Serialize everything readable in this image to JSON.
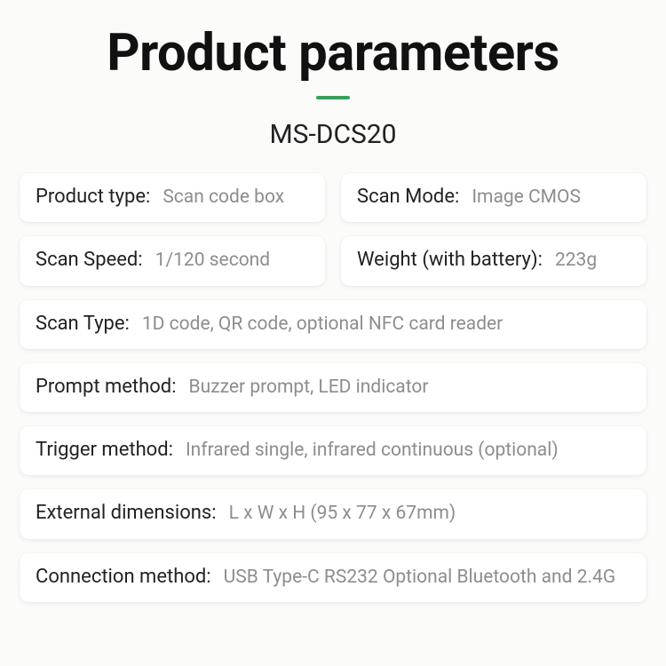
{
  "title": "Product parameters",
  "model": "MS-DCS20",
  "specs": {
    "product_type": {
      "label": "Product type:",
      "value": "Scan code box"
    },
    "scan_mode": {
      "label": "Scan Mode:",
      "value": "Image CMOS"
    },
    "scan_speed": {
      "label": "Scan Speed:",
      "value": "1/120 second"
    },
    "weight": {
      "label": "Weight (with battery):",
      "value": "223g"
    },
    "scan_type": {
      "label": "Scan Type:",
      "value": "1D code, QR code, optional NFC card reader"
    },
    "prompt_method": {
      "label": "Prompt method:",
      "value": "Buzzer prompt, LED indicator"
    },
    "trigger_method": {
      "label": "Trigger method:",
      "value": "Infrared single, infrared continuous (optional)"
    },
    "external_dimensions": {
      "label": "External dimensions:",
      "value": "L x W x H (95 x 77 x 67mm)"
    },
    "connection_method": {
      "label": "Connection method:",
      "value": "USB Type-C RS232 Optional Bluetooth and 2.4G"
    }
  }
}
